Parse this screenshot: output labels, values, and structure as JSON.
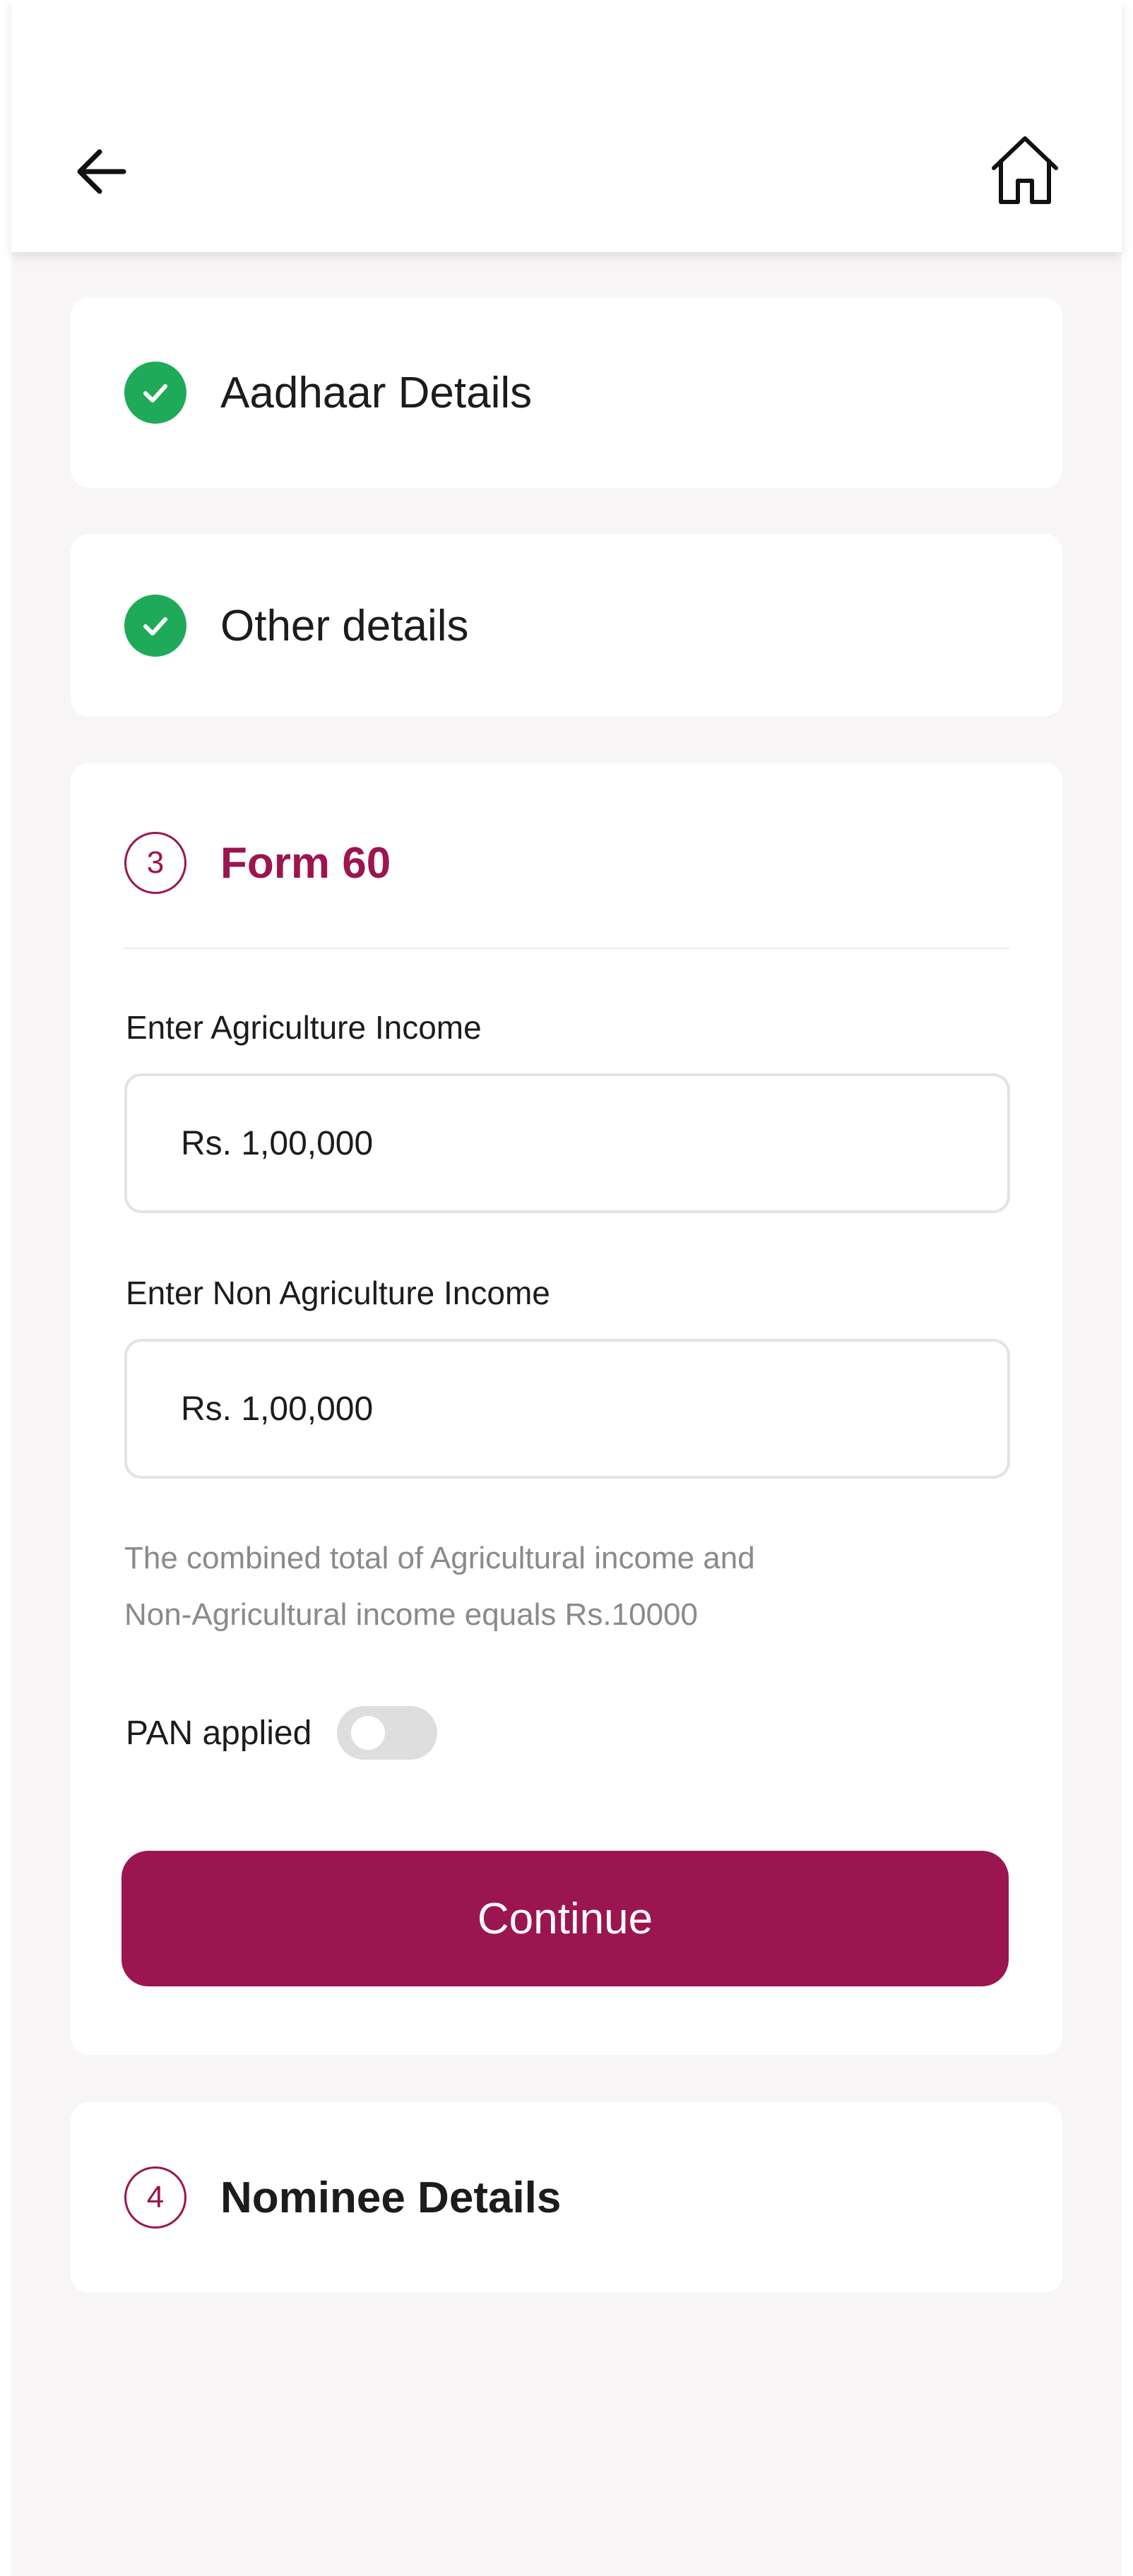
{
  "header": {
    "back_icon": "arrow-left-icon",
    "home_icon": "home-icon"
  },
  "steps": [
    {
      "title": "Aadhaar Details",
      "status": "completed",
      "icon": "check-icon"
    },
    {
      "title": "Other details",
      "status": "completed",
      "icon": "check-icon"
    },
    {
      "number": "3",
      "title": "Form 60",
      "status": "active",
      "fields": {
        "agri_income": {
          "label": "Enter Agriculture Income",
          "value": "Rs. 1,00,000"
        },
        "non_agri_income": {
          "label": "Enter Non Agriculture Income",
          "value": "Rs. 1,00,000"
        }
      },
      "helper_line1": "The combined total of Agricultural income and",
      "helper_line2": "Non-Agricultural income equals Rs.10000",
      "pan_toggle": {
        "label": "PAN applied",
        "checked": false
      },
      "continue_label": "Continue"
    },
    {
      "number": "4",
      "title": "Nominee Details",
      "status": "pending"
    }
  ],
  "colors": {
    "accent": "#9b1550",
    "success": "#1faa59",
    "background": "#f7f5f5",
    "card": "#ffffff"
  }
}
